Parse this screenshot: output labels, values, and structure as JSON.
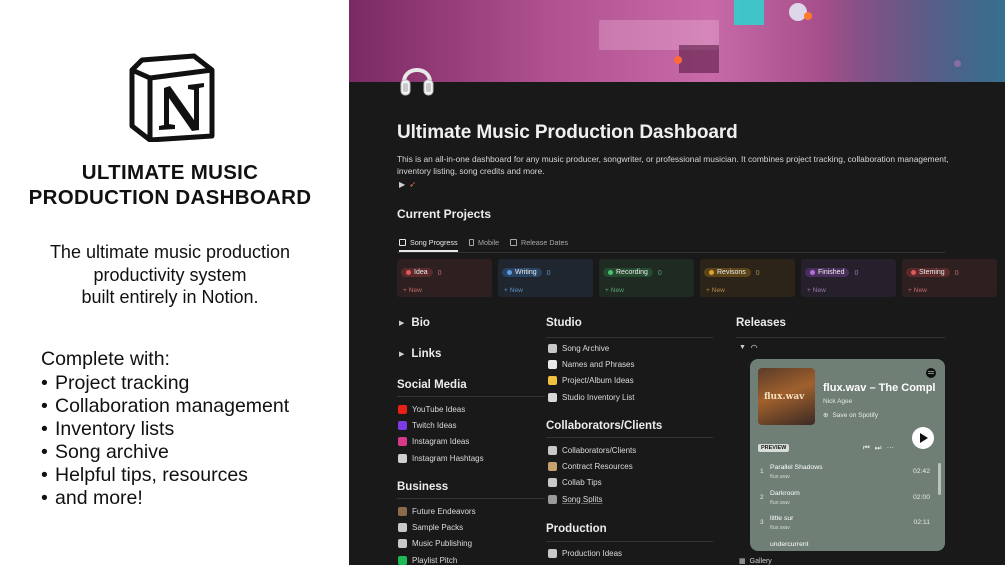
{
  "promo": {
    "title_line1": "ULTIMATE MUSIC",
    "title_line2": "PRODUCTION DASHBOARD",
    "sub_line1": "The ultimate music production",
    "sub_line2": "productivity system",
    "sub_line3": "built entirely in Notion.",
    "list_head": "Complete with:",
    "list": [
      "Project tracking",
      "Collaboration management",
      "Inventory lists",
      "Song archive",
      "Helpful tips, resources",
      "and more!"
    ],
    "logo_icon": "notion-logo-icon"
  },
  "page": {
    "icon": "headphones-icon",
    "title": "Ultimate Music Production Dashboard",
    "description": "This is an all-in-one dashboard for any music producer, songwriter, or professional musician. It combines project tracking, collaboration management, inventory listing, song credits and more.",
    "rocket_icon": "rocket-icon",
    "current_projects": "Current Projects",
    "tabs": [
      {
        "label": "Song Progress",
        "icon": "board-icon"
      },
      {
        "label": "Mobile",
        "icon": "mobile-icon"
      },
      {
        "label": "Release Dates",
        "icon": "calendar-icon"
      }
    ],
    "board": [
      {
        "label": "Idea",
        "count": "0",
        "new": "+ New",
        "bg": "#2e2020",
        "pill": "#5a2a2a",
        "dot": "#e05a5a",
        "text": "#c06a6a"
      },
      {
        "label": "Writing",
        "count": "0",
        "new": "+ New",
        "bg": "#1f2630",
        "pill": "#284262",
        "dot": "#5a9be0",
        "text": "#5f8fc0"
      },
      {
        "label": "Recording",
        "count": "0",
        "new": "+ New",
        "bg": "#1f2a22",
        "pill": "#244a30",
        "dot": "#4cc070",
        "text": "#5aa070"
      },
      {
        "label": "Revisons",
        "count": "0",
        "new": "+ New",
        "bg": "#2c2418",
        "pill": "#5a4418",
        "dot": "#e0a030",
        "text": "#b08a4a"
      },
      {
        "label": "Finished",
        "count": "0",
        "new": "+ New",
        "bg": "#261f2c",
        "pill": "#4a2e5a",
        "dot": "#b070e0",
        "text": "#9a7ab0"
      },
      {
        "label": "Steming",
        "count": "0",
        "new": "+ New",
        "bg": "#2e2020",
        "pill": "#5a2a2a",
        "dot": "#e05a5a",
        "text": "#c06a6a"
      }
    ],
    "left_col": {
      "bio": "Bio",
      "links": "Links",
      "social_media": "Social Media",
      "social_items": [
        {
          "label": "YouTube Ideas",
          "icon": "youtube-icon",
          "color": "#e62117"
        },
        {
          "label": "Twitch Ideas",
          "icon": "twitch-icon",
          "color": "#7a3ce0"
        },
        {
          "label": "Instagram Ideas",
          "icon": "instagram-icon",
          "color": "#d83a8a"
        },
        {
          "label": "Instagram Hashtags",
          "icon": "hashtag-icon",
          "color": "#cfcfcf"
        }
      ],
      "business": "Business",
      "business_items": [
        {
          "label": "Future Endeavors",
          "icon": "briefcase-icon",
          "color": "#8a6a4a"
        },
        {
          "label": "Sample Packs",
          "icon": "floppy-icon",
          "color": "#c8c8c8"
        },
        {
          "label": "Music Publishing",
          "icon": "music-note-icon",
          "color": "#c8c8c8"
        },
        {
          "label": "Playlist Pitch",
          "icon": "spotify-icon",
          "color": "#1db954"
        }
      ]
    },
    "mid_col": {
      "studio": "Studio",
      "studio_items": [
        {
          "label": "Song Archive",
          "icon": "archive-icon",
          "color": "#c8c8c8"
        },
        {
          "label": "Names and Phrases",
          "icon": "notepad-icon",
          "color": "#e8e8e8"
        },
        {
          "label": "Project/Album Ideas",
          "icon": "lightbulb-icon",
          "color": "#f0c040"
        },
        {
          "label": "Studio Inventory List",
          "icon": "document-icon",
          "color": "#d8d8d8"
        }
      ],
      "collab": "Collaborators/Clients",
      "collab_items": [
        {
          "label": "Collaborators/Clients",
          "icon": "contacts-icon",
          "color": "#c8c8c8"
        },
        {
          "label": "Contract Resources",
          "icon": "contract-icon",
          "color": "#c8a070"
        },
        {
          "label": "Collab Tips",
          "icon": "music-notes-icon",
          "color": "#c8c8c8"
        },
        {
          "label": "Song Splits",
          "icon": "pen-icon",
          "color": "#9a9a9a"
        }
      ],
      "production": "Production",
      "production_items": [
        {
          "label": "Production Ideas",
          "icon": "globe-icon",
          "color": "#c8c8c8"
        }
      ]
    },
    "right_col": {
      "releases": "Releases",
      "headphone_icon": "headphones-icon",
      "gallery": "Gallery"
    },
    "spotify": {
      "title": "flux.wav – The Compl",
      "artist": "Nick Agee",
      "save": "Save on Spotify",
      "preview": "PREVIEW",
      "art_text": "flux.wav",
      "tracks": [
        {
          "num": "1",
          "name": "Parallel Shadows",
          "artist": "flux.wav",
          "dur": "02:42"
        },
        {
          "num": "2",
          "name": "Darkroom",
          "artist": "flux.wav",
          "dur": "02:00"
        },
        {
          "num": "3",
          "name": "little sur",
          "artist": "flux.wav",
          "dur": "02:11"
        },
        {
          "num": "",
          "name": "undercurrent",
          "artist": "",
          "dur": ""
        }
      ]
    }
  }
}
